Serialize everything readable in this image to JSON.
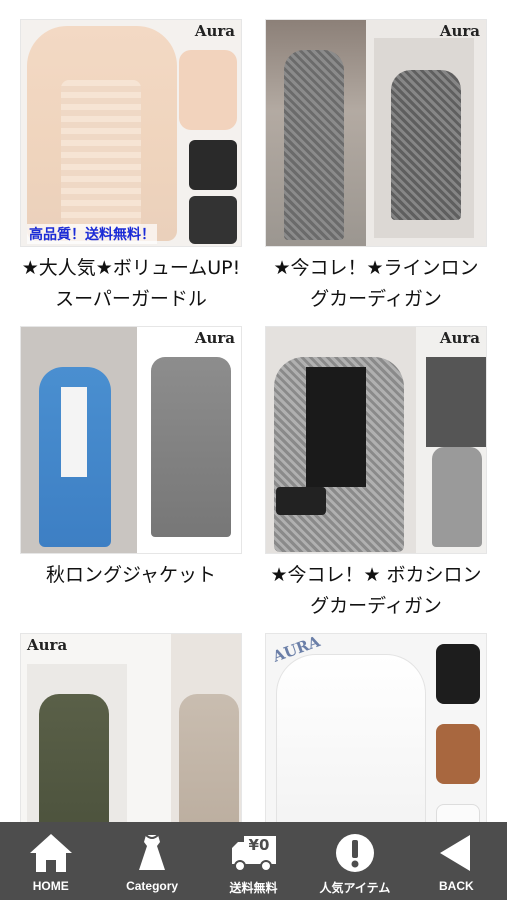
{
  "products": [
    {
      "title": "★大人気★ボリュームUP!スーパーガードル",
      "brand": "Aura",
      "promo": "高品質！送料無料！"
    },
    {
      "title": "★今コレ！★ラインロングカーディガン",
      "brand": "Aura"
    },
    {
      "title": "秋ロングジャケット",
      "brand": "Aura"
    },
    {
      "title": "★今コレ！★ ボカシロングカーディガン",
      "brand": "Aura"
    },
    {
      "title": "",
      "brand": "Aura"
    },
    {
      "title": "",
      "brand": "AURA"
    }
  ],
  "tabbar": {
    "items": [
      {
        "label": "HOME",
        "icon": "home-icon"
      },
      {
        "label": "Category",
        "icon": "dress-icon"
      },
      {
        "label": "送料無料",
        "icon": "delivery-truck-icon",
        "icon_text": "¥0"
      },
      {
        "label": "人気アイテム",
        "icon": "exclamation-icon"
      },
      {
        "label": "BACK",
        "icon": "back-arrow-icon"
      }
    ]
  }
}
